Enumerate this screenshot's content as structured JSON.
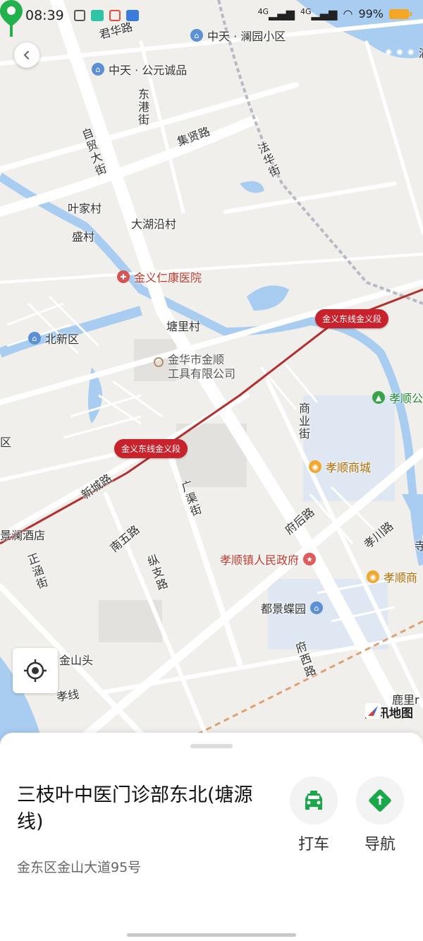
{
  "status_bar": {
    "time": "08:39",
    "signal1": "4G",
    "signal2": "4G",
    "battery": "99%"
  },
  "map": {
    "roads": {
      "junhua_road": "君华路",
      "ziamao_street": "自贸大街",
      "donggang_street": "东港街",
      "jixian_road": "集贤路",
      "fahua_street": "法华街",
      "xincheng_road": "新城路",
      "guangqu_street": "广渠街",
      "nanwu_road": "南五路",
      "zongzhi_road": "纵支路",
      "zhenghan_street": "正涵街",
      "fuhou_road": "府后路",
      "xiaochuan_road": "孝川路",
      "shangye_street": "商业街",
      "fuxi_road": "府西路",
      "xiao_line": "孝线"
    },
    "places": {
      "yejia_village": "叶家村",
      "sheng_village": "盛村",
      "dahuyan_village": "大湖沿村",
      "tangli_village": "塘里村",
      "beixin_district": "北新区",
      "district_left": "区",
      "jinshan_tou": "金山头",
      "luli": "鹿里r"
    },
    "pois": {
      "lanyuan": "中天 · 澜园小区",
      "gongyuan": "中天 · 公元诚品",
      "manjue": "满坳",
      "hospital": "金义仁康医院",
      "company": "金华市金顺\n工具有限公司",
      "xiaoshun_park": "孝顺公",
      "xiaoshun_mall": "孝顺商城",
      "jinglan_hotel": "景澜酒店",
      "government": "孝顺镇人民政府",
      "dujing_garden": "都景蝶园",
      "xiaoshun_shop": "孝顺商",
      "si": "寺"
    },
    "rail_labels": [
      "金义东线金义段",
      "金义东线金义段"
    ],
    "logo_text": "腾讯地图",
    "colors": {
      "water": "#a8cdf0",
      "rail": "#b2312f",
      "pin": "#22b14c",
      "rail_tag": "#c8232c",
      "taxi": "#1aa84a",
      "nav": "#1aa84a"
    }
  },
  "sheet": {
    "place_name": "三枝叶中医门诊部东北(塘源线)",
    "address": "金东区金山大道95号",
    "actions": [
      {
        "label": "打车",
        "icon": "taxi-icon"
      },
      {
        "label": "导航",
        "icon": "navigation-icon"
      }
    ]
  }
}
